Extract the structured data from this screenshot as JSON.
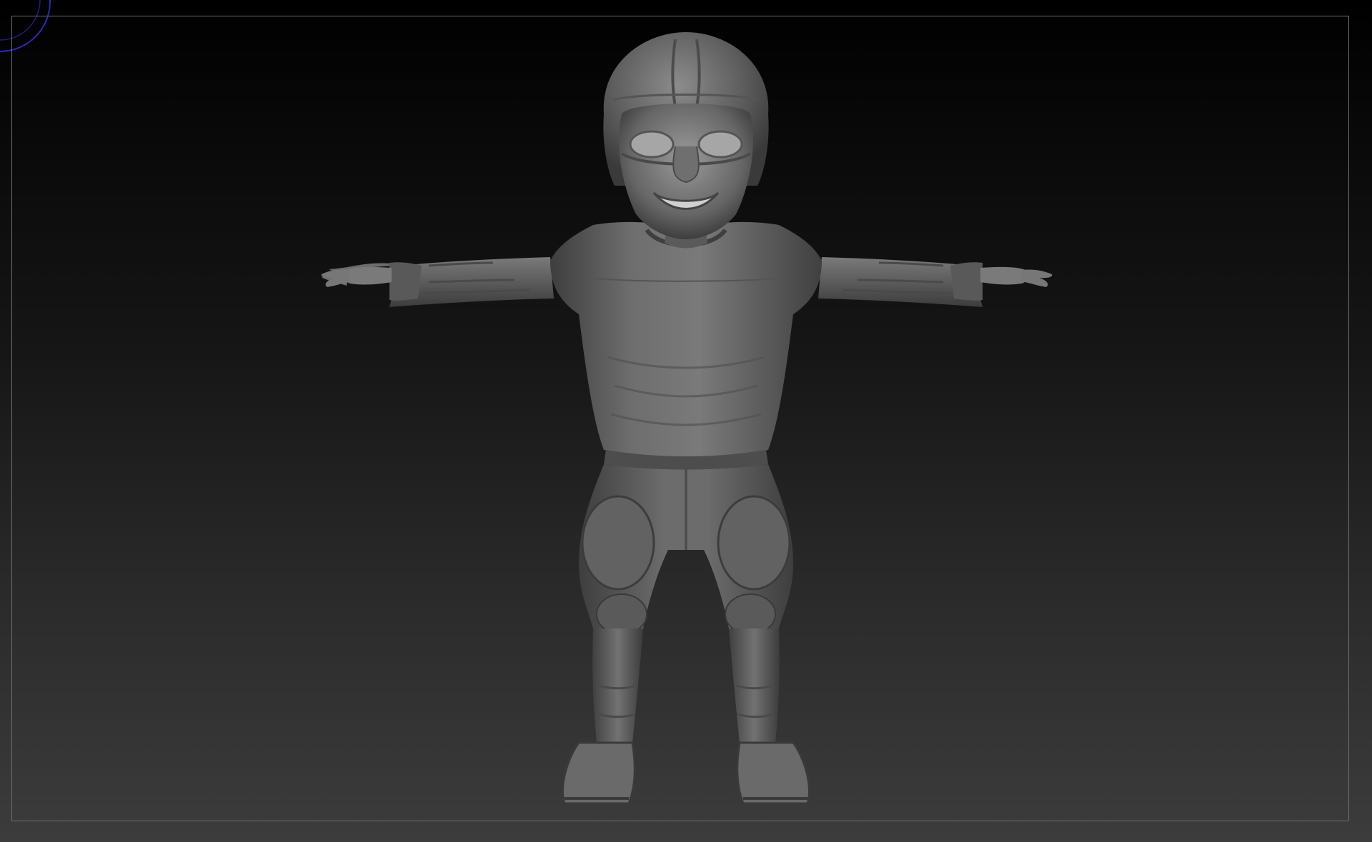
{
  "viewport": {
    "background_top": "#000000",
    "background_bottom": "#3c3c3c",
    "frame_color": "#6e6e6e",
    "gyro_color": "#2a2ab8"
  },
  "model": {
    "icon": "sculpted-football-player-figure",
    "material_color": "#6a6a6a"
  }
}
